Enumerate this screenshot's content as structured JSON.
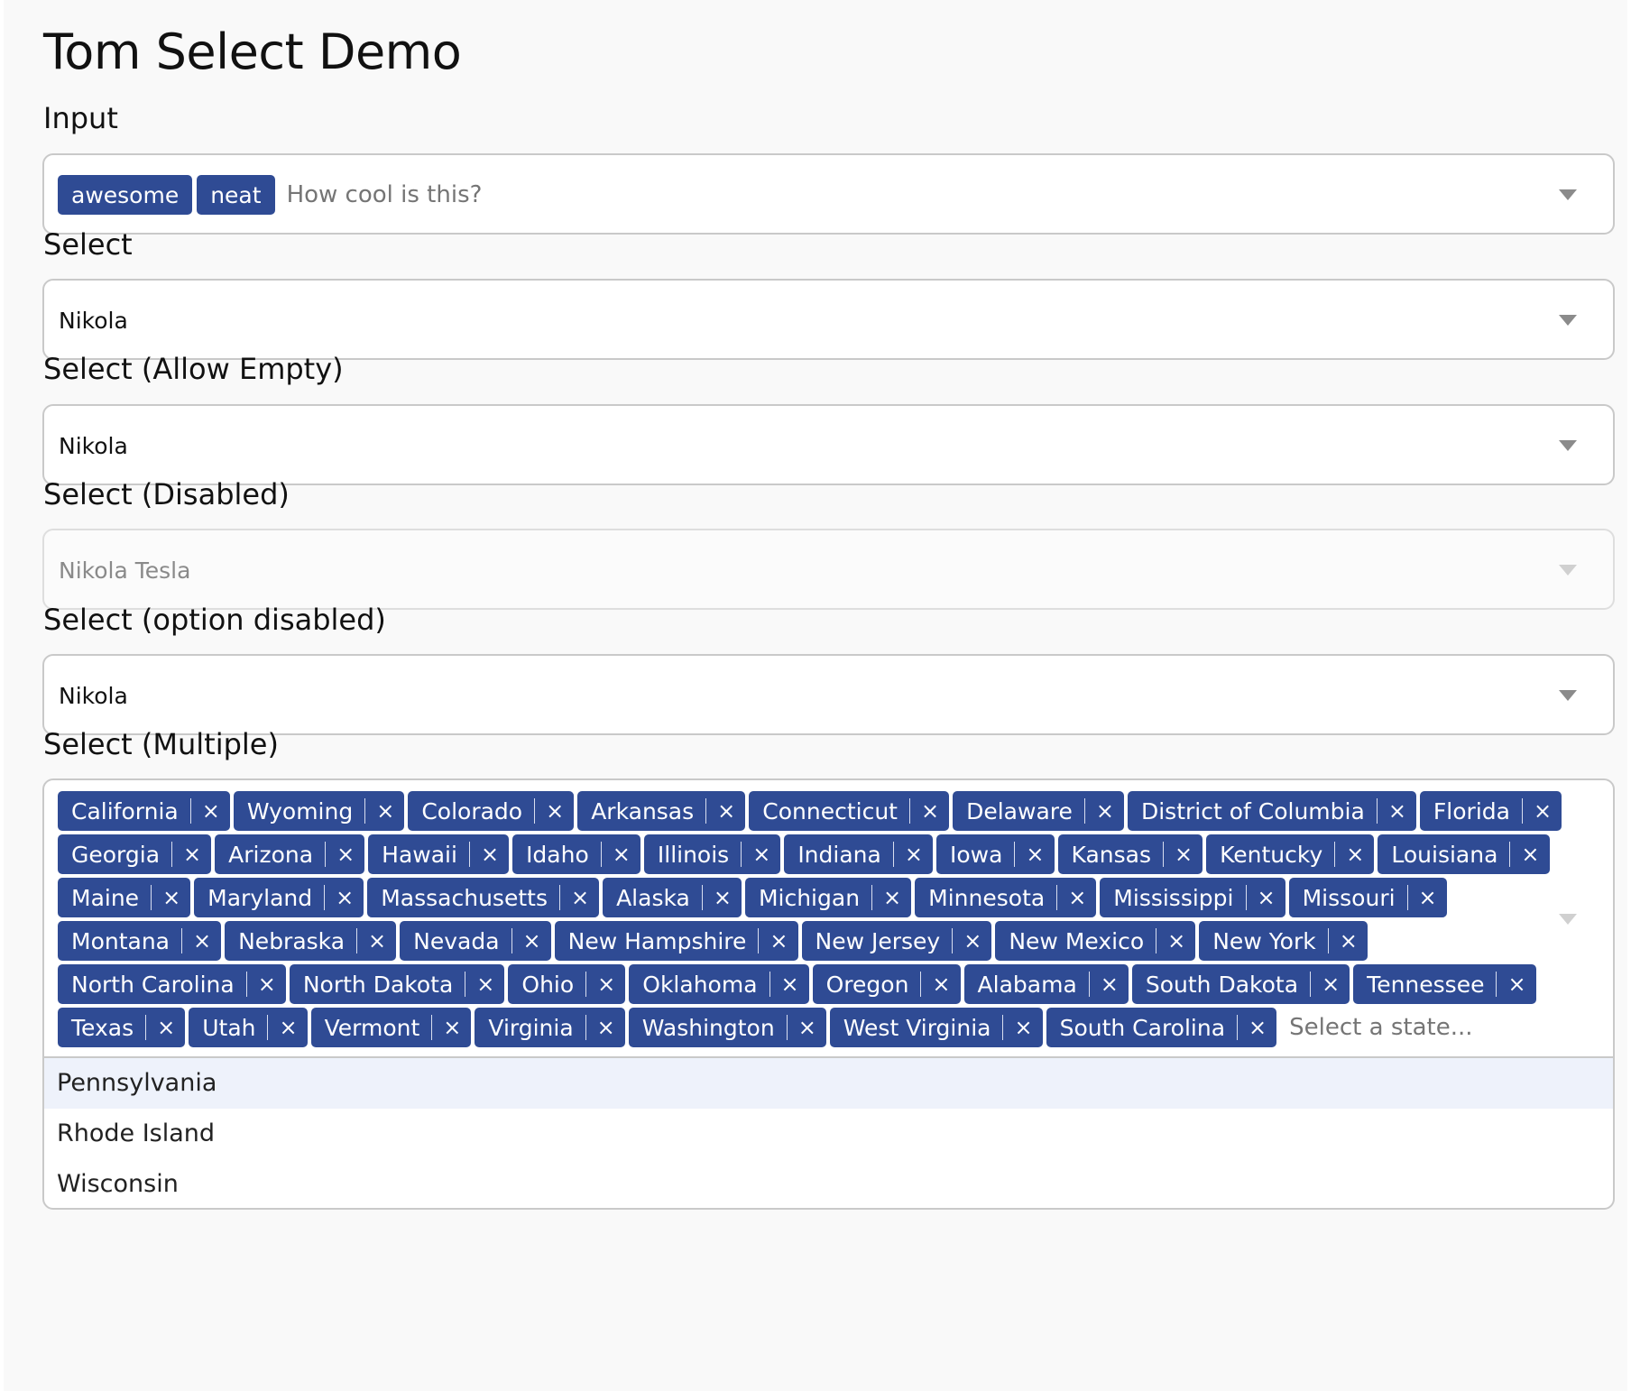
{
  "page": {
    "title": "Tom Select Demo"
  },
  "input_field": {
    "label": "Input",
    "tags": [
      "awesome",
      "neat"
    ],
    "placeholder": "How cool is this?"
  },
  "select": {
    "label": "Select",
    "value": "Nikola"
  },
  "select_allow_empty": {
    "label": "Select (Allow Empty)",
    "value": "Nikola"
  },
  "select_disabled": {
    "label": "Select (Disabled)",
    "value": "Nikola Tesla"
  },
  "select_option_disabled": {
    "label": "Select (option disabled)",
    "value": "Nikola"
  },
  "select_multiple": {
    "label": "Select (Multiple)",
    "remove_glyph": "×",
    "selected": [
      "California",
      "Wyoming",
      "Colorado",
      "Arkansas",
      "Connecticut",
      "Delaware",
      "District of Columbia",
      "Florida",
      "Georgia",
      "Arizona",
      "Hawaii",
      "Idaho",
      "Illinois",
      "Indiana",
      "Iowa",
      "Kansas",
      "Kentucky",
      "Louisiana",
      "Maine",
      "Maryland",
      "Massachusetts",
      "Alaska",
      "Michigan",
      "Minnesota",
      "Mississippi",
      "Missouri",
      "Montana",
      "Nebraska",
      "Nevada",
      "New Hampshire",
      "New Jersey",
      "New Mexico",
      "New York",
      "North Carolina",
      "North Dakota",
      "Ohio",
      "Oklahoma",
      "Oregon",
      "Alabama",
      "South Dakota",
      "Tennessee",
      "Texas",
      "Utah",
      "Vermont",
      "Virginia",
      "Washington",
      "West Virginia",
      "South Carolina"
    ],
    "placeholder": "Select a state...",
    "options": [
      "Pennsylvania",
      "Rhode Island",
      "Wisconsin"
    ],
    "active_option": "Pennsylvania"
  },
  "colors": {
    "tag_bg": "#2f4b94",
    "tag_text": "#ffffff",
    "active_option_bg": "#eef2fb",
    "page_bg": "#f9f9f9"
  },
  "icons": {
    "caret": "chevron-down-icon",
    "remove": "close-icon"
  }
}
